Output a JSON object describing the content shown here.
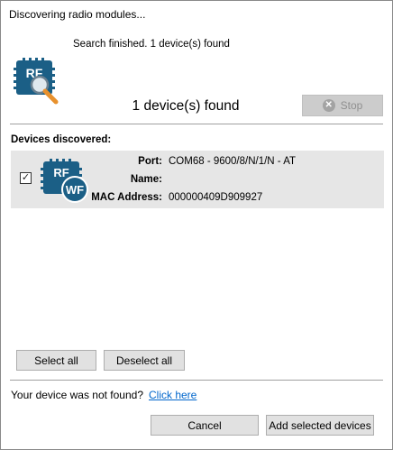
{
  "window": {
    "title": "Discovering radio modules..."
  },
  "status": {
    "message": "Search finished. 1 device(s) found",
    "found_count_text": "1 device(s) found",
    "stop_label": "Stop",
    "logo_text": "RF"
  },
  "devices": {
    "heading": "Devices discovered:",
    "items": [
      {
        "checked": true,
        "icon": "rf-wifi-module-icon",
        "logo_text": "RF",
        "badge_text": "WF",
        "port_label": "Port:",
        "port_value": "COM68 - 9600/8/N/1/N - AT",
        "name_label": "Name:",
        "name_value": "",
        "mac_label": "MAC Address:",
        "mac_value": "000000409D909927"
      }
    ]
  },
  "actions": {
    "select_all": "Select all",
    "deselect_all": "Deselect all"
  },
  "footer": {
    "not_found_text": "Your device was not found?",
    "click_here": "Click here",
    "cancel": "Cancel",
    "add_selected": "Add selected devices"
  },
  "colors": {
    "logo_blue": "#1b5f86",
    "accent_orange": "#e8912d",
    "link_blue": "#0066cc",
    "row_background": "#e6e6e6"
  }
}
